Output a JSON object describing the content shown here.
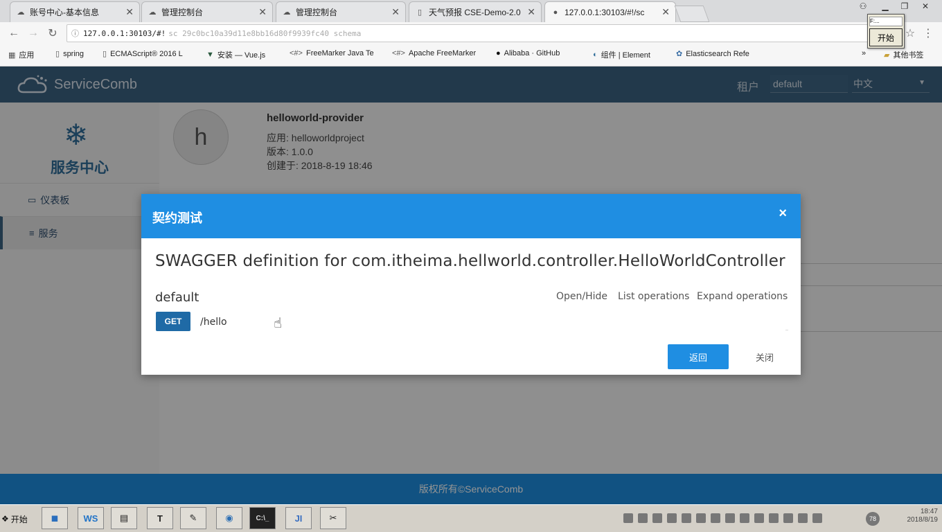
{
  "browser": {
    "tabs": [
      {
        "label": "账号中心-基本信息",
        "icon": "cloud-icon"
      },
      {
        "label": "管理控制台",
        "icon": "cloud-icon"
      },
      {
        "label": "管理控制台",
        "icon": "cloud-icon"
      },
      {
        "label": "天气预报 CSE-Demo-2.0",
        "icon": "page-icon"
      },
      {
        "label": "127.0.0.1:30103/#!/sc",
        "icon": "incognito-icon"
      }
    ],
    "address": {
      "host": "127.0.0.1:30103/#!",
      "path": "sc 29c0bc10a39d11e8bb16d80f9939fc40 schema"
    },
    "bookmarks": [
      "应用",
      "spring",
      "ECMAScript® 2016 L",
      "安装 — Vue.js",
      "FreeMarker Java Te",
      "Apache FreeMarker",
      "Alibaba · GitHub",
      "组件 | Element",
      "Elasticsearch Refe"
    ],
    "other_bookmarks": "其他书签",
    "start_popup": {
      "mini": "F:...",
      "button": "开始"
    }
  },
  "app": {
    "logo": "ServiceComb",
    "tenant_label": "租户",
    "tenant_value": "default",
    "language": "中文",
    "sidebar": {
      "title": "服务中心",
      "items": [
        {
          "label": "仪表板",
          "icon": "monitor-icon"
        },
        {
          "label": "服务",
          "icon": "list-icon"
        }
      ]
    },
    "service": {
      "avatar_letter": "h",
      "name": "helloworld-provider",
      "app": "应用: helloworldproject",
      "version": "版本: 1.0.0",
      "created": "创建于: 2018-8-19 18:46"
    },
    "footer": "版权所有©ServiceComb"
  },
  "modal": {
    "title": "契约测试",
    "close": "×",
    "swagger_title": "SWAGGER definition for com.itheima.hellworld.controller.HelloWorldController",
    "group": "default",
    "links": [
      "Open/Hide",
      "List operations",
      "Expand operations"
    ],
    "operation": {
      "method": "GET",
      "path": "/hello"
    },
    "back_button": "返回",
    "close_button": "关闭"
  },
  "taskbar": {
    "start": "开始",
    "apps": [
      "",
      "WS",
      "",
      "T",
      "",
      "",
      "C:\\_",
      "JI",
      ""
    ],
    "tray_badge": "78",
    "clock_time": "18:47",
    "clock_date": "2018/8/19"
  }
}
